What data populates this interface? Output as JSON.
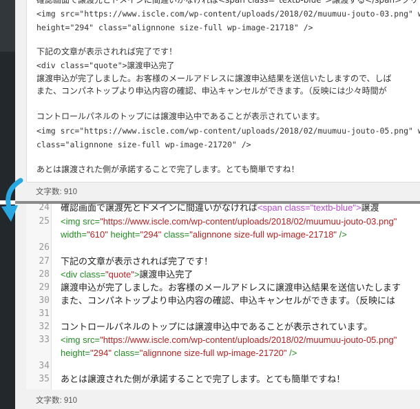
{
  "top_editor": {
    "lines": [
      {
        "text": "確認画面で譲渡先とドメインに間違いがなければ<span class=\"textb-blue\">譲渡する</span>クリ",
        "mono": false
      },
      {
        "text": "<img src=\"https://www.iscle.com/wp-content/uploads/2018/02/muumuu-jouto-03.png\" wid",
        "mono": true
      },
      {
        "text": "height=\"294\" class=\"alignnone size-full wp-image-21718\" />",
        "mono": true
      },
      {
        "text": "",
        "mono": false
      },
      {
        "text": "下記の文章が表示されれば完了です！",
        "mono": false
      },
      {
        "text": "<div class=\"quote\">譲渡申込完了",
        "mono": true
      },
      {
        "text": "譲渡申込が完了しました。お客様のメールアドレスに譲渡申込結果を送信いたしますので、しば",
        "mono": false
      },
      {
        "text": "また、コンパネトップより申込内容の確認、申込キャンセルができます。（反映には少々時間が",
        "mono": false
      },
      {
        "text": "",
        "mono": false
      },
      {
        "text": "コントロールパネルのトップには譲渡申込中であることが表示されています。",
        "mono": false
      },
      {
        "text": "<img src=\"https://www.iscle.com/wp-content/uploads/2018/02/muumuu-jouto-05.png\" wid",
        "mono": true
      },
      {
        "text": "class=\"alignnone size-full wp-image-21720\" />",
        "mono": true
      },
      {
        "text": "",
        "mono": false
      },
      {
        "text": "あとは譲渡された側が承諾することで完了します。とても簡単ですね！",
        "mono": false
      }
    ],
    "status": "文字数: 910"
  },
  "bottom_editor": {
    "line_numbers": [
      "24",
      "25",
      "",
      "26",
      "27",
      "28",
      "29",
      "30",
      "31",
      "32",
      "33",
      "",
      "34",
      "35"
    ],
    "line1_text": "確認画面で譲渡先とドメインに間違いがなければ",
    "line1_tag": "<span class=\"textb-blue\">",
    "line1_tail": "譲渡",
    "img1_a": "<img src=",
    "img1_src": "\"https://www.iscle.com/wp-content/uploads/2018/02/muumuu-jouto-03.png\"",
    "img1_w_attr": "width=",
    "img1_w": "\"610\"",
    "img1_h_attr": " height=",
    "img1_h": "\"294\"",
    "img1_c_attr": " class=",
    "img1_c": "\"alignnone size-full wp-image-21718\"",
    "img_close": " />",
    "l27": "下記の文章が表示されれば完了です！",
    "div_open": "<div class=",
    "div_class": "\"quote\"",
    "div_gt": ">",
    "div_text": "譲渡申込完了",
    "l29": "譲渡申込が完了しました。お客様のメールアドレスに譲渡申込結果を送信いたします",
    "l30": "また、コンパネトップより申込内容の確認、申込キャンセルができます。（反映には",
    "l32": "コントロールパネルのトップには譲渡申込中であることが表示されています。",
    "img2_src": "\"https://www.iscle.com/wp-content/uploads/2018/02/muumuu-jouto-05.png\"",
    "img2_h_attr": "height=",
    "img2_h": "\"294\"",
    "img2_c": "\"alignnone size-full wp-image-21720\"",
    "l35": "あとは譲渡された側が承諾することで完了します。とても簡単ですね！",
    "status": "文字数: 910"
  },
  "colors": {
    "arrow": "#2aa7e0",
    "tag": "#228b22",
    "string": "#b22222"
  },
  "icons": {
    "arrow": "curved-down-arrow-icon"
  }
}
